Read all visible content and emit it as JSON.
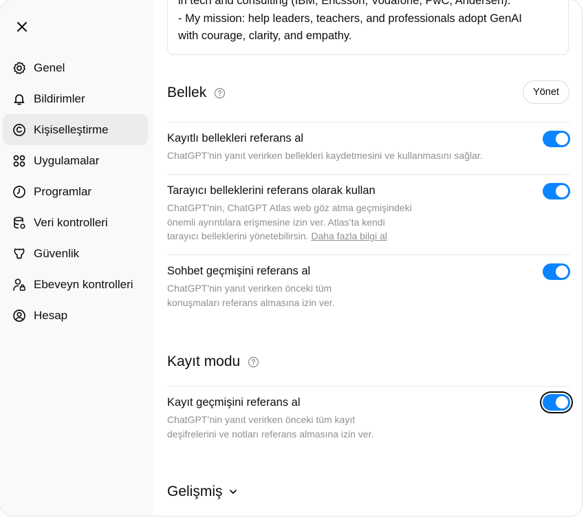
{
  "sidebar": {
    "close_label": "Close",
    "items": [
      {
        "label": "Genel",
        "icon": "gear-icon",
        "active": false
      },
      {
        "label": "Bildirimler",
        "icon": "bell-icon",
        "active": false
      },
      {
        "label": "Kişiselleştirme",
        "icon": "personalization-icon",
        "active": true
      },
      {
        "label": "Uygulamalar",
        "icon": "apps-grid-icon",
        "active": false
      },
      {
        "label": "Programlar",
        "icon": "clock-icon",
        "active": false
      },
      {
        "label": "Veri kontrolleri",
        "icon": "database-gear-icon",
        "active": false
      },
      {
        "label": "Güvenlik",
        "icon": "shield-icon",
        "active": false
      },
      {
        "label": "Ebeveyn kontrolleri",
        "icon": "user-lock-icon",
        "active": false
      },
      {
        "label": "Hesap",
        "icon": "account-icon",
        "active": false
      }
    ]
  },
  "bio": {
    "lines": [
      "in tech and consulting (IBM, Ericsson, Vodafone, PwC, Andersen).",
      "- My mission: help leaders, teachers, and professionals adopt GenAI",
      "with courage, clarity, and empathy."
    ]
  },
  "memory": {
    "title": "Bellek",
    "manage_label": "Yönet",
    "settings": [
      {
        "title": "Kayıtlı bellekleri referans al",
        "desc": [
          "ChatGPT'nin yanıt verirken bellekleri kaydetmesini ve kullanmasını sağlar."
        ],
        "enabled": true
      },
      {
        "title": "Tarayıcı belleklerini referans olarak kullan",
        "desc": [
          "ChatGPT'nin, ChatGPT Atlas web göz atma geçmişindeki",
          "önemli ayrıntılara erişmesine izin ver. Atlas’ta kendi",
          "tarayıcı belleklerini yönetebilirsin."
        ],
        "link": "Daha fazla bilgi al",
        "enabled": true
      },
      {
        "title": "Sohbet geçmişini referans al",
        "desc": [
          "ChatGPT'nin yanıt verirken önceki tüm",
          "konuşmaları referans almasına izin ver."
        ],
        "enabled": true
      }
    ]
  },
  "record": {
    "title": "Kayıt modu",
    "settings": [
      {
        "title": "Kayıt geçmişini referans al",
        "desc": [
          "ChatGPT’nin yanıt verirken önceki tüm kayıt",
          "deşifrelerini ve notları referans almasına izin ver."
        ],
        "enabled": true
      }
    ]
  },
  "advanced": {
    "label": "Gelişmiş"
  },
  "colors": {
    "toggle_on": "#0a84ff",
    "sidebar_bg": "#f9f9f9",
    "active_item_bg": "#ececec",
    "desc_text": "#8f8f8f"
  }
}
